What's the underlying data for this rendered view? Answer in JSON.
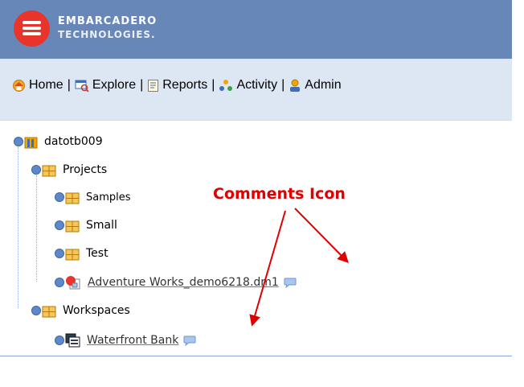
{
  "brand": {
    "line1": "EMBARCADERO",
    "line2": "TECHNOLOGIES."
  },
  "nav": {
    "items": [
      {
        "label": "Home",
        "icon": "home-icon"
      },
      {
        "label": "Explore",
        "icon": "explore-icon"
      },
      {
        "label": "Reports",
        "icon": "reports-icon"
      },
      {
        "label": "Activity",
        "icon": "activity-icon"
      },
      {
        "label": "Admin",
        "icon": "admin-icon"
      }
    ],
    "separator": "|"
  },
  "tree": {
    "root": "datotb009",
    "projects": "Projects",
    "samples": "Samples",
    "small": "Small",
    "test": "Test",
    "model": "Adventure Works_demo6218.dm1",
    "workspaces": "Workspaces",
    "waterfront": "Waterfront Bank"
  },
  "annotation": {
    "label": "Comments Icon",
    "color": "#e00000"
  },
  "colors": {
    "header": "#6787b9",
    "navbar": "#dde6f3",
    "logo": "#e8342a"
  }
}
